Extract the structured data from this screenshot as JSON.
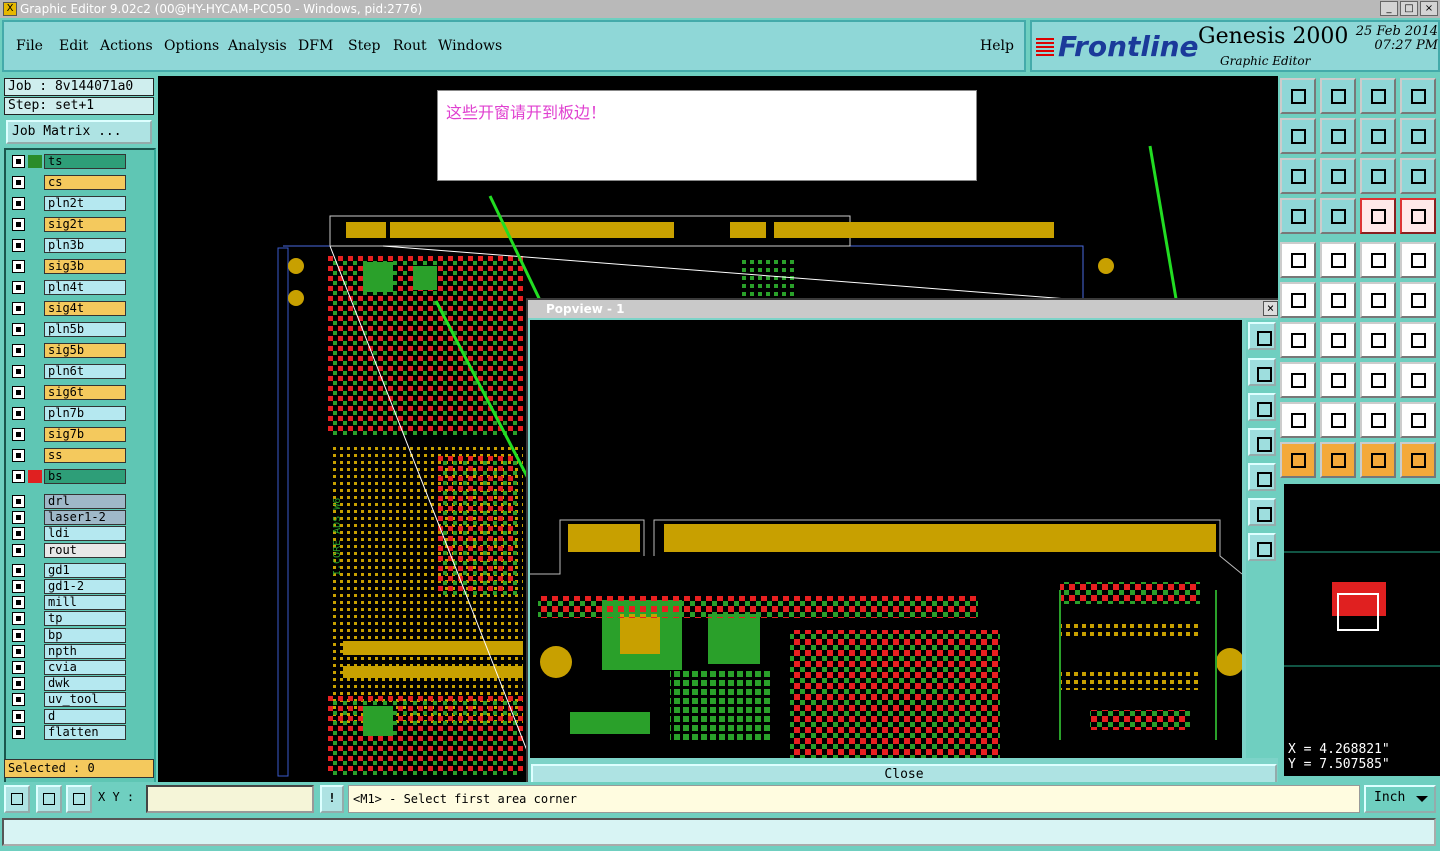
{
  "window": {
    "title": "Graphic Editor 9.02c2 (00@HY-HYCAM-PC050 - Windows, pid:2776)"
  },
  "menu": {
    "file": "File",
    "edit": "Edit",
    "actions": "Actions",
    "options": "Options",
    "analysis": "Analysis",
    "dfm": "DFM",
    "step": "Step",
    "rout": "Rout",
    "windows": "Windows",
    "help": "Help"
  },
  "brand": {
    "company": "Frontline",
    "product": "Genesis 2000",
    "subtitle": "Graphic Editor",
    "date": "25 Feb 2014",
    "time": "07:27 PM"
  },
  "job": {
    "job_line": "Job : 8v144071a0",
    "step_line": "Step: set+1",
    "matrix_button": "Job Matrix ..."
  },
  "layers": [
    {
      "name": "ts",
      "color": "#2e9e78",
      "swatch": "#2a8c2a"
    },
    {
      "name": "cs",
      "color": "#f4c95d",
      "swatch": ""
    },
    {
      "name": "pln2t",
      "color": "#b5e8f0",
      "swatch": ""
    },
    {
      "name": "sig2t",
      "color": "#f4c95d",
      "swatch": ""
    },
    {
      "name": "pln3b",
      "color": "#b5e8f0",
      "swatch": ""
    },
    {
      "name": "sig3b",
      "color": "#f4c95d",
      "swatch": ""
    },
    {
      "name": "pln4t",
      "color": "#b5e8f0",
      "swatch": ""
    },
    {
      "name": "sig4t",
      "color": "#f4c95d",
      "swatch": ""
    },
    {
      "name": "pln5b",
      "color": "#b5e8f0",
      "swatch": ""
    },
    {
      "name": "sig5b",
      "color": "#f4c95d",
      "swatch": ""
    },
    {
      "name": "pln6t",
      "color": "#b5e8f0",
      "swatch": ""
    },
    {
      "name": "sig6t",
      "color": "#f4c95d",
      "swatch": ""
    },
    {
      "name": "pln7b",
      "color": "#b5e8f0",
      "swatch": ""
    },
    {
      "name": "sig7b",
      "color": "#f4c95d",
      "swatch": ""
    },
    {
      "name": "ss",
      "color": "#f4c95d",
      "swatch": ""
    },
    {
      "name": "bs",
      "color": "#2e9e78",
      "swatch": "#e02020"
    },
    {
      "name": "drl",
      "color": "#9fb8c8",
      "swatch": ""
    },
    {
      "name": "laser1-2",
      "color": "#9fb8c8",
      "swatch": ""
    },
    {
      "name": "ldi",
      "color": "#b5e8f0",
      "swatch": ""
    },
    {
      "name": "rout",
      "color": "#e8e8e8",
      "swatch": ""
    },
    {
      "name": "gd1",
      "color": "#b5e8f0",
      "swatch": ""
    },
    {
      "name": "gd1-2",
      "color": "#b5e8f0",
      "swatch": ""
    },
    {
      "name": "mill",
      "color": "#b5e8f0",
      "swatch": ""
    },
    {
      "name": "tp",
      "color": "#b5e8f0",
      "swatch": ""
    },
    {
      "name": "bp",
      "color": "#b5e8f0",
      "swatch": ""
    },
    {
      "name": "npth",
      "color": "#b5e8f0",
      "swatch": ""
    },
    {
      "name": "cvia",
      "color": "#b5e8f0",
      "swatch": ""
    },
    {
      "name": "dwk",
      "color": "#b5e8f0",
      "swatch": ""
    },
    {
      "name": "uv_tool",
      "color": "#b5e8f0",
      "swatch": ""
    },
    {
      "name": "d",
      "color": "#b5e8f0",
      "swatch": ""
    },
    {
      "name": "flatten",
      "color": "#b5e8f0",
      "swatch": ""
    }
  ],
  "selected": "Selected : 0",
  "note": "这些开窗请开到板边！",
  "popview": {
    "title": "Popview - 1",
    "close_label": "Close"
  },
  "coords": {
    "x": "X = 4.268821\"",
    "y": "Y = 7.507585\""
  },
  "bottom": {
    "xy_label": "X Y :",
    "xy_value": "",
    "prompt": "<M1> - Select first area corner",
    "units": "Inch"
  }
}
